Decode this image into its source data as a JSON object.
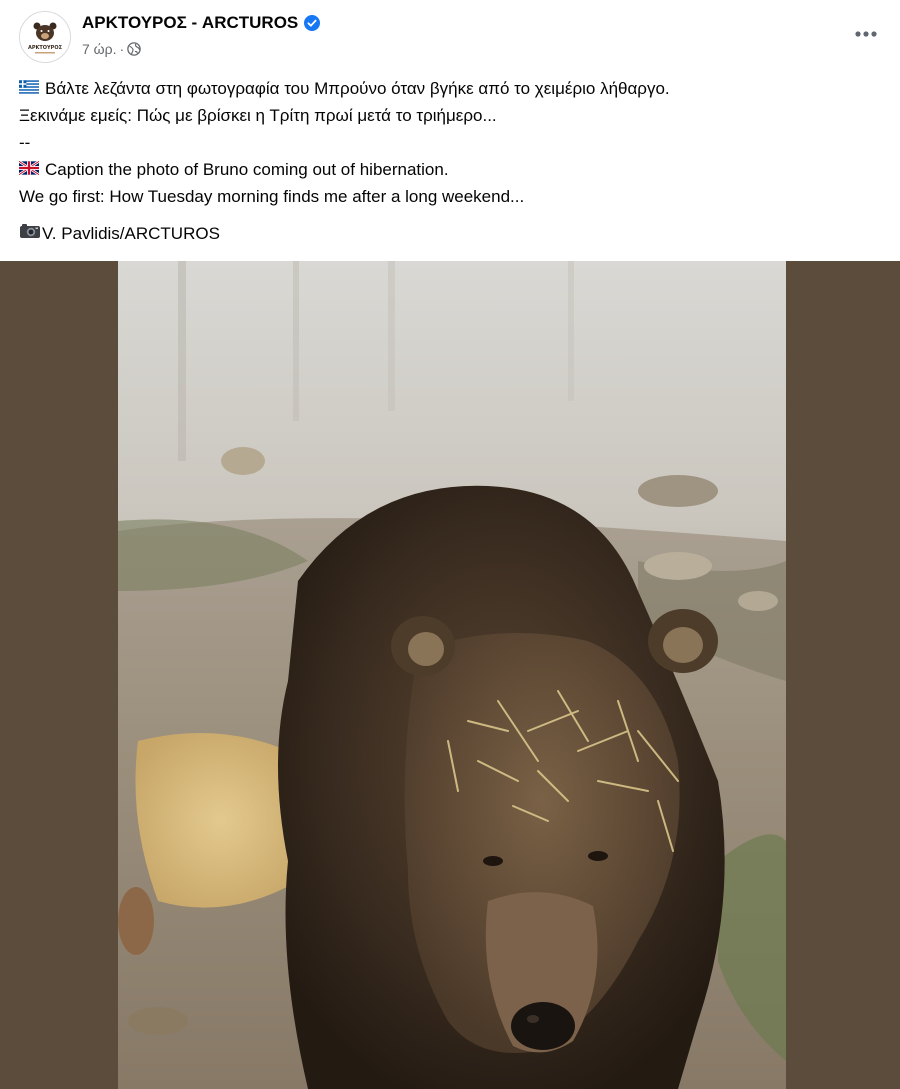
{
  "page": {
    "name": "ΑΡΚΤΟΥΡΟΣ - ARCTUROS",
    "logo_text": "ΑΡΚΤΟΥΡΟΣ",
    "timestamp": "7 ώρ.",
    "separator": "·",
    "verified_icon": "verified-badge-icon",
    "audience_icon": "globe-icon"
  },
  "post": {
    "greek_flag_icon": "greek-flag-icon",
    "uk_flag_icon": "uk-flag-icon",
    "camera_icon": "camera-icon",
    "line1": "Βάλτε λεζάντα στη φωτογραφία του Μπρούνο όταν βγήκε από το χειμέριο λήθαργο.",
    "line2": "Ξεκινάμε εμείς: Πώς με βρίσκει η Τρίτη πρωί μετά το τριήμερο...",
    "divider": "--",
    "line3": "Caption the photo of Bruno coming out of hibernation.",
    "line4": "We go first: How Tuesday morning finds me after a long weekend...",
    "credit": "V. Pavlidis/ARCTUROS"
  },
  "colors": {
    "accent": "#1877f2",
    "secondary_text": "#65676b",
    "photo_backdrop": "#5c4c3c"
  },
  "more_icon": "more-options-icon"
}
